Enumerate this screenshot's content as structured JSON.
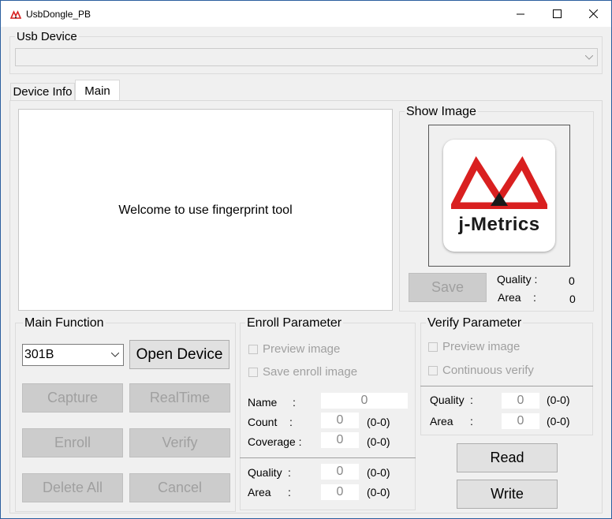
{
  "window": {
    "title": "UsbDongle_PB",
    "minimize": "—",
    "maximize": "☐",
    "close": "✕"
  },
  "usb_device": {
    "label": "Usb Device",
    "value": ""
  },
  "tabs": [
    {
      "label": "Device Info"
    },
    {
      "label": "Main"
    }
  ],
  "display": {
    "message": "Welcome to use fingerprint tool"
  },
  "show_image": {
    "label": "Show Image",
    "logo_text": "j-Metrics",
    "save_label": "Save",
    "quality_label": "Quality :",
    "quality_value": "0",
    "area_label": "Area",
    "area_colon": ":",
    "area_value": "0"
  },
  "main_function": {
    "label": "Main Function",
    "sensor_value": "301B",
    "open_device": "Open Device",
    "capture": "Capture",
    "realtime": "RealTime",
    "enroll": "Enroll",
    "verify": "Verify",
    "delete_all": "Delete All",
    "cancel": "Cancel"
  },
  "enroll_parameter": {
    "label": "Enroll Parameter",
    "preview_image": "Preview image",
    "save_enroll_image": "Save enroll image",
    "name_label": "Name",
    "name_colon": ":",
    "name_value": "0",
    "count_label": "Count",
    "count_colon": ":",
    "count_value": "0",
    "count_range": "(0-0)",
    "coverage_label": "Coverage :",
    "coverage_value": "0",
    "coverage_range": "(0-0)",
    "quality_label": "Quality",
    "quality_colon": ":",
    "quality_value": "0",
    "quality_range": "(0-0)",
    "area_label": "Area",
    "area_colon": ":",
    "area_value": "0",
    "area_range": "(0-0)"
  },
  "verify_parameter": {
    "label": "Verify Parameter",
    "preview_image": "Preview image",
    "continuous_verify": "Continuous verify",
    "quality_label": "Quality",
    "quality_colon": ":",
    "quality_value": "0",
    "quality_range": "(0-0)",
    "area_label": "Area",
    "area_colon": ":",
    "area_value": "0",
    "area_range": "(0-0)"
  },
  "actions": {
    "read": "Read",
    "write": "Write"
  },
  "colors": {
    "accent_red": "#d92020",
    "border_blue": "#2b5f9e"
  }
}
